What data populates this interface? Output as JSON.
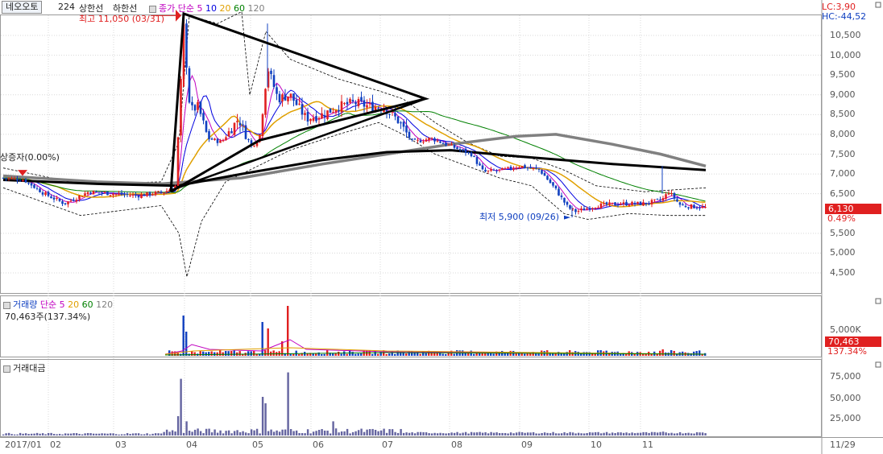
{
  "header": {
    "stock_name": "네오오토",
    "count": "224",
    "limit_up": "상한선",
    "limit_down": "하한선",
    "ma_label": "종가 단순",
    "ma_periods": [
      "5",
      "10",
      "20",
      "60",
      "120"
    ],
    "ma_colors": [
      "#c000c0",
      "#0000e0",
      "#e0a000",
      "#008000",
      "#808080"
    ],
    "lc": "LC:3,90",
    "hc": "HC:-44,52"
  },
  "annotations": {
    "high": "최고 11,050 (03/31)",
    "low": "최저 5,900 (09/26)",
    "capital": "상증자(0.00%)"
  },
  "price_axis": {
    "ticks": [
      "10,500",
      "10,000",
      "9,500",
      "9,000",
      "8,500",
      "8,000",
      "7,500",
      "7,000",
      "6,500",
      "5,500",
      "5,000",
      "4,500"
    ],
    "current_price": "6,130",
    "current_change": "0.49%"
  },
  "volume_panel": {
    "title": "거래량",
    "ma_label": "단순",
    "ma_periods": [
      "5",
      "20",
      "60",
      "120"
    ],
    "value": "70,463주(137.34%)",
    "tick": "5,000K",
    "tag_value": "70,463",
    "tag_pct": "137.34%"
  },
  "amount_panel": {
    "title": "거래대금",
    "ticks": [
      "75,000",
      "50,000",
      "25,000"
    ]
  },
  "x_axis": {
    "labels": [
      "2017/01",
      "02",
      "03",
      "04",
      "05",
      "06",
      "07",
      "08",
      "09",
      "10",
      "11"
    ],
    "right_date": "11/29"
  },
  "colors": {
    "up": "#e02020",
    "down": "#1040c0",
    "grid": "#d8d8d8",
    "axis_text": "#555555",
    "panel_bar": "#6464a0"
  },
  "chart_data": [
    {
      "type": "candlestick",
      "title": "",
      "ylim": [
        4200,
        11050
      ],
      "grid": true,
      "months": [
        "2017/01",
        "02",
        "03",
        "04",
        "05",
        "06",
        "07",
        "08",
        "09",
        "10",
        "11"
      ],
      "monthly_close": [
        6850,
        6350,
        6450,
        8300,
        8700,
        8400,
        8700,
        7600,
        7100,
        6150,
        6150
      ],
      "high": {
        "value": 11050,
        "date": "03/31"
      },
      "low": {
        "value": 5900,
        "date": "09/26"
      },
      "current": 6130
    },
    {
      "type": "bar",
      "title": "거래량",
      "tick_labels": [
        "5,000K"
      ],
      "current": 70463,
      "current_pct": 137.34
    },
    {
      "type": "bar",
      "title": "거래대금",
      "ylim": [
        0,
        100000
      ],
      "tick_labels": [
        "75,000",
        "50,000",
        "25,000"
      ]
    }
  ]
}
